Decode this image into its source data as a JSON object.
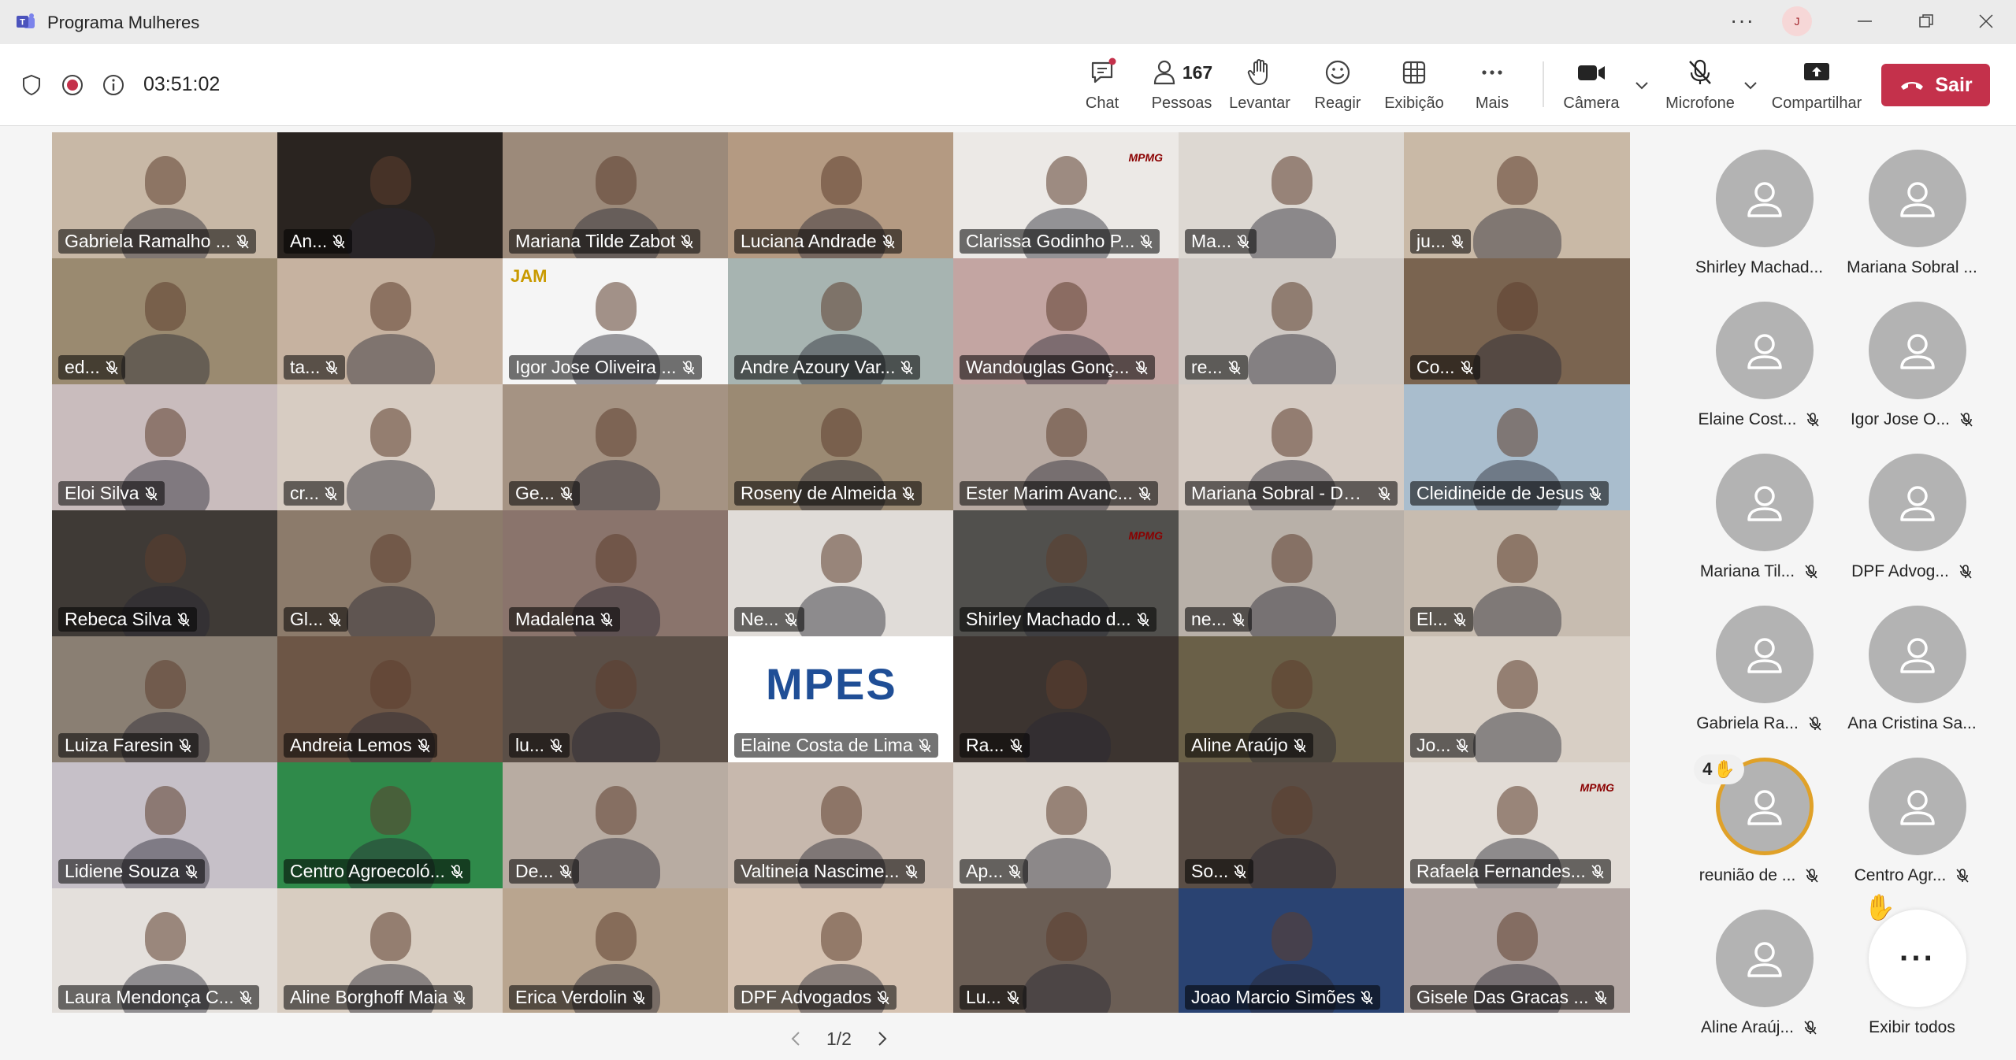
{
  "window": {
    "title": "Programa Mulheres",
    "more": "···",
    "avatar_initial": "J"
  },
  "meeting": {
    "elapsed": "03:51:02",
    "people_count": "167"
  },
  "toolbar": {
    "chat": "Chat",
    "people": "Pessoas",
    "raise": "Levantar",
    "react": "Reagir",
    "view": "Exibição",
    "more": "Mais",
    "camera": "Câmera",
    "mic": "Microfone",
    "share": "Compartilhar",
    "leave": "Sair"
  },
  "grid": {
    "tiles": [
      {
        "name": "Gabriela Ramalho ...",
        "bg": "#c8b8a6"
      },
      {
        "name": "An...",
        "bg": "#2a2420"
      },
      {
        "name": "Mariana Tilde Zabot",
        "bg": "#9c8a7a"
      },
      {
        "name": "Luciana Andrade",
        "bg": "#b49a82"
      },
      {
        "name": "Clarissa Godinho P...",
        "bg": "#ece9e6",
        "logo": "MPMG"
      },
      {
        "name": "Ma...",
        "bg": "#ddd8d2"
      },
      {
        "name": "ju...",
        "bg": "#c9b9a6"
      },
      {
        "name": "ed...",
        "bg": "#9a8a70"
      },
      {
        "name": "ta...",
        "bg": "#c6b2a0"
      },
      {
        "name": "Igor Jose Oliveira ...",
        "bg": "#f5f5f5",
        "logo": "JAM"
      },
      {
        "name": "Andre Azoury Var...",
        "bg": "#a7b4b1"
      },
      {
        "name": "Wandouglas Gonç...",
        "bg": "#c3a5a2"
      },
      {
        "name": "re...",
        "bg": "#cfc9c4"
      },
      {
        "name": "Co...",
        "bg": "#7a6450"
      },
      {
        "name": "Eloi Silva",
        "bg": "#c9bcbd"
      },
      {
        "name": "cr...",
        "bg": "#d7ccc2"
      },
      {
        "name": "Ge...",
        "bg": "#a59383"
      },
      {
        "name": "Roseny de Almeida",
        "bg": "#9b8a73"
      },
      {
        "name": "Ester Marim Avanc...",
        "bg": "#b8aaa2"
      },
      {
        "name": "Mariana Sobral - DPES",
        "bg": "#d5cbc3"
      },
      {
        "name": "Cleidineide de Jesus",
        "bg": "#a9bdcd"
      },
      {
        "name": "Rebeca  Silva",
        "bg": "#3f3a36"
      },
      {
        "name": "Gl...",
        "bg": "#8c7b6b"
      },
      {
        "name": "Madalena",
        "bg": "#8a746c"
      },
      {
        "name": "Ne...",
        "bg": "#e0dcd8"
      },
      {
        "name": "Shirley Machado d...",
        "bg": "#51504d",
        "logo": "MPMG"
      },
      {
        "name": "ne...",
        "bg": "#b8b0a8"
      },
      {
        "name": "El...",
        "bg": "#c7bcb0"
      },
      {
        "name": "Luiza Faresin",
        "bg": "#8a7f73"
      },
      {
        "name": "Andreia Lemos",
        "bg": "#6d5646"
      },
      {
        "name": "lu...",
        "bg": "#5b4f47"
      },
      {
        "name": "Elaine Costa de Lima",
        "bg": "#ffffff",
        "logo": "MPES"
      },
      {
        "name": "Ra...",
        "bg": "#3c3430"
      },
      {
        "name": "Aline Araújo",
        "bg": "#6a6048"
      },
      {
        "name": "Jo...",
        "bg": "#d8cfc5"
      },
      {
        "name": "Lidiene Souza",
        "bg": "#c6c0c8"
      },
      {
        "name": "Centro Agroecoló...",
        "bg": "#2f8a4a"
      },
      {
        "name": "De...",
        "bg": "#b8aca2"
      },
      {
        "name": "Valtineia Nascime...",
        "bg": "#c7b8ad"
      },
      {
        "name": "Ap...",
        "bg": "#ded7d0"
      },
      {
        "name": "So...",
        "bg": "#5a4e46"
      },
      {
        "name": "Rafaela Fernandes...",
        "bg": "#e2dcd6",
        "logo": "MPMG"
      },
      {
        "name": "Laura Mendonça C...",
        "bg": "#e4e0dc"
      },
      {
        "name": "Aline Borghoff Maia",
        "bg": "#d8cdc1"
      },
      {
        "name": "Erica Verdolin",
        "bg": "#b9a58f"
      },
      {
        "name": "DPF Advogados",
        "bg": "#d6c3b2"
      },
      {
        "name": "Lu...",
        "bg": "#6b5e55"
      },
      {
        "name": "Joao Marcio Simões",
        "bg": "#2a4372"
      },
      {
        "name": "Gisele Das Gracas ...",
        "bg": "#b3a7a3"
      }
    ]
  },
  "pager": {
    "label": "1/2"
  },
  "roster": [
    {
      "name": "Shirley Machad...",
      "muted": false
    },
    {
      "name": "Mariana Sobral ...",
      "muted": false
    },
    {
      "name": "Elaine Cost...",
      "muted": true
    },
    {
      "name": "Igor Jose O...",
      "muted": true
    },
    {
      "name": "Mariana Til...",
      "muted": true
    },
    {
      "name": "DPF Advog...",
      "muted": true
    },
    {
      "name": "Gabriela Ra...",
      "muted": true
    },
    {
      "name": "Ana Cristina Sa...",
      "muted": false
    },
    {
      "name": "reunião de ...",
      "muted": true,
      "hand_count": "4"
    },
    {
      "name": "Centro Agr...",
      "muted": true
    },
    {
      "name": "Aline Araúj...",
      "muted": true
    },
    {
      "name": "Exibir todos",
      "muted": false,
      "more": "···"
    }
  ]
}
